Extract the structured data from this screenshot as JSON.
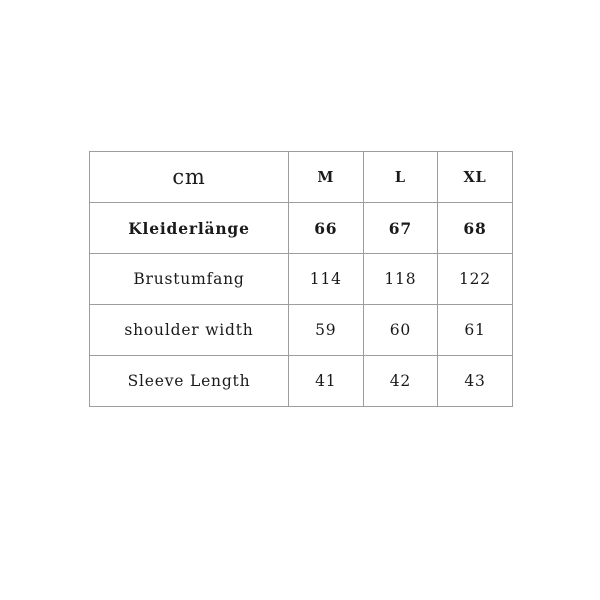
{
  "chart_data": {
    "type": "table",
    "title": "",
    "unit_label": "cm",
    "columns": [
      "cm",
      "M",
      "L",
      "XL"
    ],
    "rows": [
      {
        "label": "Kleiderlänge",
        "values": [
          "66",
          "67",
          "68"
        ],
        "emphasis": true
      },
      {
        "label": "Brustumfang",
        "values": [
          "114",
          "118",
          "122"
        ],
        "emphasis": false
      },
      {
        "label": "shoulder width",
        "values": [
          "59",
          "60",
          "61"
        ],
        "emphasis": false
      },
      {
        "label": "Sleeve Length",
        "values": [
          "41",
          "42",
          "43"
        ],
        "emphasis": false
      }
    ],
    "colors": {
      "background": "#ffffff",
      "border": "#9d9d9d",
      "text": "#1a1a1a"
    }
  }
}
